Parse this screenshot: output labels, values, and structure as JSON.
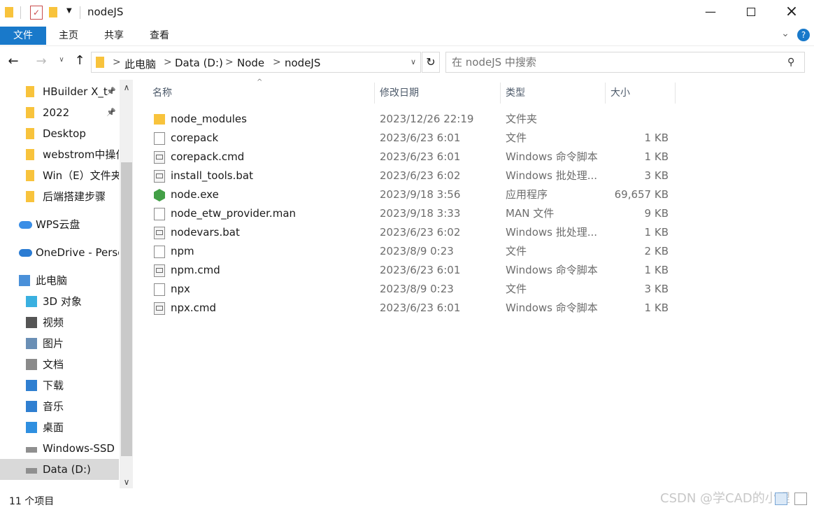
{
  "window": {
    "title": "nodeJS"
  },
  "ribbon": {
    "tabs": [
      "文件",
      "主页",
      "共享",
      "查看"
    ]
  },
  "address": {
    "crumbs": [
      "此电脑",
      "Data (D:)",
      "Node",
      "nodeJS"
    ]
  },
  "search": {
    "placeholder": "在 nodeJS 中搜索"
  },
  "sidebar": {
    "items": [
      {
        "label": "HBuilder X_t",
        "icon": "folder-icon",
        "pinned": true
      },
      {
        "label": "2022",
        "icon": "folder-icon",
        "pinned": true
      },
      {
        "label": "Desktop",
        "icon": "folder-icon"
      },
      {
        "label": "webstrom中操作",
        "icon": "folder-icon"
      },
      {
        "label": "Win（E）文件夹",
        "icon": "folder-icon"
      },
      {
        "label": "后端搭建步骤",
        "icon": "folder-icon"
      },
      {
        "label": "WPS云盘",
        "icon": "cloud-icon"
      },
      {
        "label": "OneDrive - Personal",
        "icon": "onedrive-icon"
      },
      {
        "label": "此电脑",
        "icon": "computer-icon"
      },
      {
        "label": "3D 对象",
        "icon": "3d-objects-icon"
      },
      {
        "label": "视频",
        "icon": "video-icon"
      },
      {
        "label": "图片",
        "icon": "picture-icon"
      },
      {
        "label": "文档",
        "icon": "document-icon"
      },
      {
        "label": "下载",
        "icon": "download-icon"
      },
      {
        "label": "音乐",
        "icon": "music-icon"
      },
      {
        "label": "桌面",
        "icon": "desktop-icon"
      },
      {
        "label": "Windows-SSD (",
        "icon": "drive-icon"
      },
      {
        "label": "Data (D:)",
        "icon": "drive-icon",
        "selected": true
      }
    ]
  },
  "columns": {
    "name": "名称",
    "modified": "修改日期",
    "type": "类型",
    "size": "大小"
  },
  "files": [
    {
      "name": "node_modules",
      "modified": "2023/12/26 22:19",
      "type": "文件夹",
      "size": "",
      "icon": "folder-icon"
    },
    {
      "name": "corepack",
      "modified": "2023/6/23 6:01",
      "type": "文件",
      "size": "1 KB",
      "icon": "file-icon"
    },
    {
      "name": "corepack.cmd",
      "modified": "2023/6/23 6:01",
      "type": "Windows 命令脚本",
      "size": "1 KB",
      "icon": "script-icon"
    },
    {
      "name": "install_tools.bat",
      "modified": "2023/6/23 6:02",
      "type": "Windows 批处理...",
      "size": "3 KB",
      "icon": "script-icon"
    },
    {
      "name": "node.exe",
      "modified": "2023/9/18 3:56",
      "type": "应用程序",
      "size": "69,657 KB",
      "icon": "nodejs-icon"
    },
    {
      "name": "node_etw_provider.man",
      "modified": "2023/9/18 3:33",
      "type": "MAN 文件",
      "size": "9 KB",
      "icon": "file-icon"
    },
    {
      "name": "nodevars.bat",
      "modified": "2023/6/23 6:02",
      "type": "Windows 批处理...",
      "size": "1 KB",
      "icon": "script-icon"
    },
    {
      "name": "npm",
      "modified": "2023/8/9 0:23",
      "type": "文件",
      "size": "2 KB",
      "icon": "file-icon"
    },
    {
      "name": "npm.cmd",
      "modified": "2023/6/23 6:01",
      "type": "Windows 命令脚本",
      "size": "1 KB",
      "icon": "script-icon"
    },
    {
      "name": "npx",
      "modified": "2023/8/9 0:23",
      "type": "文件",
      "size": "3 KB",
      "icon": "file-icon"
    },
    {
      "name": "npx.cmd",
      "modified": "2023/6/23 6:01",
      "type": "Windows 命令脚本",
      "size": "1 KB",
      "icon": "script-icon"
    }
  ],
  "status": {
    "count": "11 个项目"
  },
  "watermark": "CSDN @学CAD的小理",
  "colors": {
    "accent": "#1979ca",
    "folder": "#f8c33c",
    "selection": "#d9d9d9",
    "nodejs": "#43a047"
  }
}
